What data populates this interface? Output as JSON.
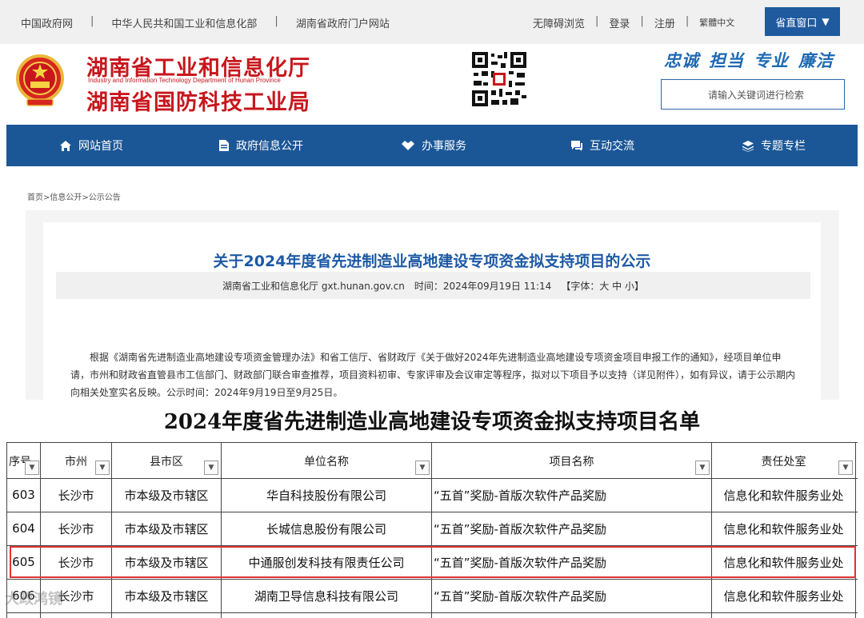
{
  "topbar": {
    "left_links": [
      "中国政府网",
      "中华人民共和国工业和信息化部",
      "湖南省政府门户网站"
    ],
    "accessibility": "无障碍浏览",
    "login": "登录",
    "register": "注册",
    "traditional": "繁體中文",
    "portal": "省直窗口",
    "separator": "|"
  },
  "header": {
    "title_line1": "湖南省工业和信息化厅",
    "title_en": "Industry and Information Technology Department of Hunan Province",
    "title_line2": "湖南省国防科技工业局",
    "slogan": [
      "忠诚",
      "担当",
      "专业",
      "廉洁"
    ],
    "search_placeholder": "请输入关键词进行检索"
  },
  "nav": {
    "items": [
      "网站首页",
      "政府信息公开",
      "办事服务",
      "互动交流",
      "专题专栏"
    ]
  },
  "breadcrumb": "首页>信息公开>公示公告",
  "article": {
    "title": "关于2024年度省先进制造业高地建设专项资金拟支持项目的公示",
    "source": "湖南省工业和信息化厅 gxt.hunan.gov.cn",
    "time": "时间：2024年09月19日 11:14",
    "font_size": "【字体：大 中 小】",
    "body": "根据《湖南省先进制造业高地建设专项资金管理办法》和省工信厅、省财政厅《关于做好2024年先进制造业高地建设专项资金项目申报工作的通知》，经项目单位申请，市州和财政省直管县市工信部门、财政部门联合审查推荐，项目资料初审、专家评审及会议审定等程序，拟对以下项目予以支持（详见附件），如有异议，请于公示期内向相关处室实名反映。公示时间：2024年9月19日至9月25日。"
  },
  "sheet": {
    "title": "2024年度省先进制造业高地建设专项资金拟支持项目名单",
    "headers": [
      "序号",
      "市州",
      "县市区",
      "单位名称",
      "项目名称",
      "责任处室"
    ],
    "rows": [
      [
        "603",
        "长沙市",
        "市本级及市辖区",
        "华自科技股份有限公司",
        "“五首”奖励-首版次软件产品奖励",
        "信息化和软件服务业处"
      ],
      [
        "604",
        "长沙市",
        "市本级及市辖区",
        "长城信息股份有限公司",
        "“五首”奖励-首版次软件产品奖励",
        "信息化和软件服务业处"
      ],
      [
        "605",
        "长沙市",
        "市本级及市辖区",
        "中通服创发科技有限责任公司",
        "“五首”奖励-首版次软件产品奖励",
        "信息化和软件服务业处"
      ],
      [
        "606",
        "长沙市",
        "市本级及市辖区",
        "湖南卫导信息科技有限公司",
        "“五首”奖励-首版次软件产品奖励",
        "信息化和软件服务业处"
      ]
    ],
    "highlighted_row": "605"
  },
  "watermark": "大政鸿镜",
  "colors": {
    "brand_red": "#c8161d",
    "nav_blue": "#1b5797",
    "title_blue": "#1d5aa5",
    "highlight": "#dd3333"
  }
}
